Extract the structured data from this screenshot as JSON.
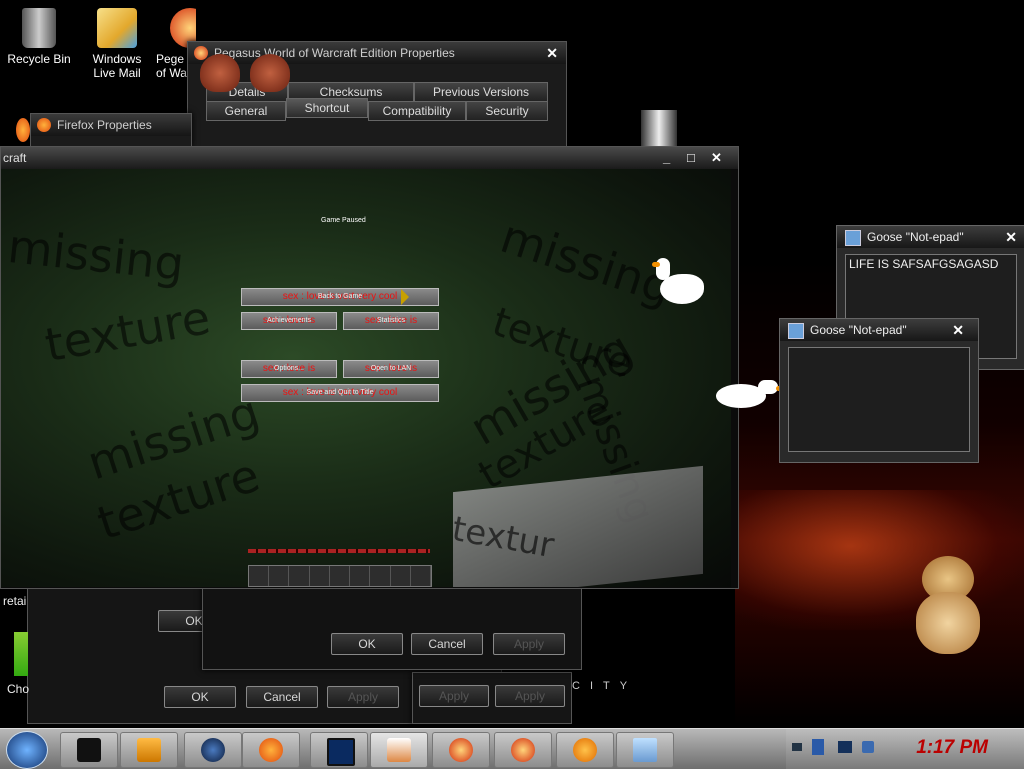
{
  "desktop_icons": [
    {
      "label_line1": "Recycle Bin",
      "label_line2": "",
      "icon": "recycle-bin-icon"
    },
    {
      "label_line1": "Windows",
      "label_line2": "Live Mail",
      "icon": "mail-icon"
    },
    {
      "label_line1": "Pege",
      "label_line2": "of Wa",
      "icon": "pegasus-icon"
    }
  ],
  "properties_window": {
    "title": "Pegasus World of Warcraft Edition Properties",
    "tabs_row1": [
      "Details",
      "Checksums",
      "Previous Versions"
    ],
    "tabs_row2": [
      "General",
      "Shortcut",
      "Compatibility",
      "Security"
    ]
  },
  "firefox_window": {
    "title": "Firefox Properties"
  },
  "game_window": {
    "title": "craft",
    "minimize": "_",
    "maximize": "□",
    "close": "✕",
    "tiny_caption": "Game Paused",
    "menu_buttons": [
      {
        "text": "sex : love is vert very cool",
        "overlay": "Back to Game"
      },
      {
        "text": "sex : love is",
        "overlay": "Achievements"
      },
      {
        "text": "sex : love is",
        "overlay": "Statistics"
      },
      {
        "text": "sex : love is",
        "overlay": "Options..."
      },
      {
        "text": "sex : love is",
        "overlay": "Open to LAN"
      },
      {
        "text": "sex : love is vert very cool",
        "overlay": "Save and Quit to Title"
      }
    ],
    "texture_words": [
      "missing",
      "texture",
      "missing",
      "texture",
      "missing",
      "texture",
      "missing",
      "texture",
      "missing",
      "textur"
    ]
  },
  "notepad_back": {
    "title": "Goose \"Not-epad\"",
    "close": "✕",
    "content": "LIFE IS SAFSAFGSAGASD"
  },
  "notepad_front": {
    "title": "Goose \"Not-epad\"",
    "close": "✕",
    "content": ""
  },
  "dialogs": {
    "ok": "OK",
    "cancel": "Cancel",
    "apply": "Apply",
    "left_fragment": "retai",
    "left_fragment2": "Cho"
  },
  "wallpaper_text": "CITY",
  "taskbar": {
    "items": [
      "start-orb",
      "terminal-icon",
      "media-player-icon",
      "globe-icon",
      "firefox-icon",
      "monitor-icon",
      "java-icon",
      "pegasus-icon",
      "pegasus-icon",
      "goldfish-icon",
      "notepad-icon"
    ],
    "clock": "1:17 PM"
  }
}
